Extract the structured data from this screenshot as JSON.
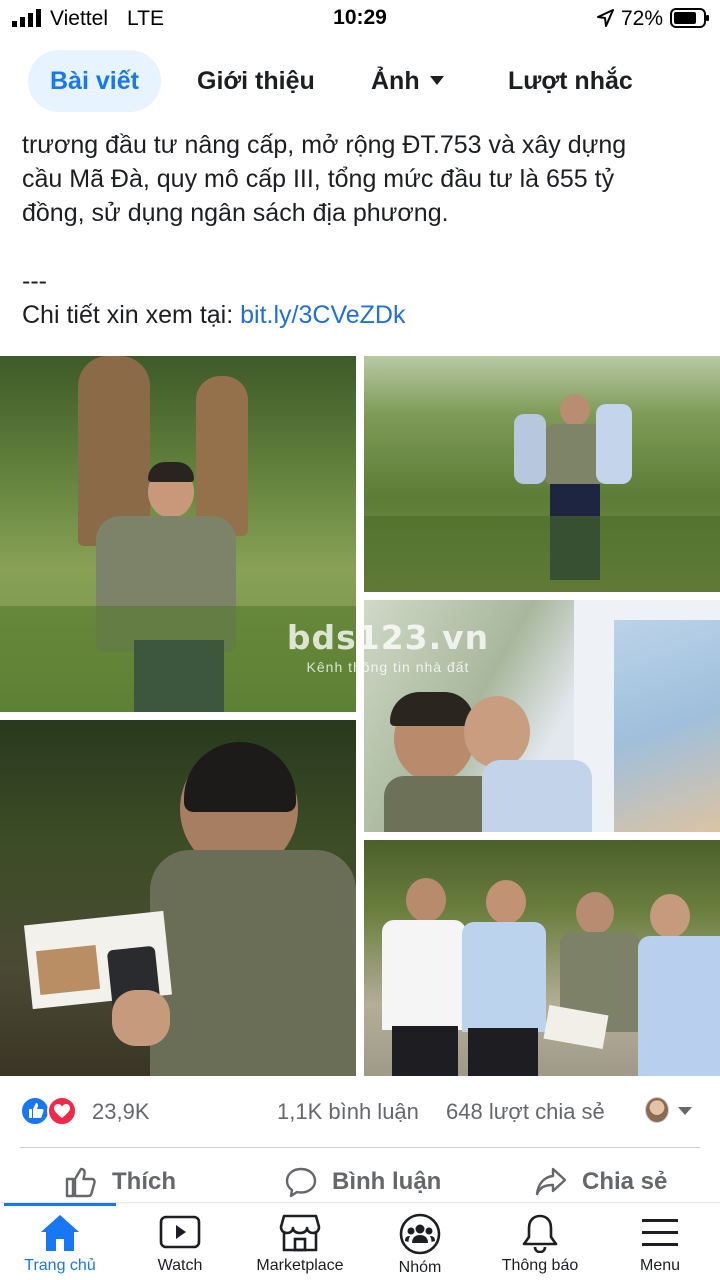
{
  "status_bar": {
    "carrier": "Viettel",
    "network": "LTE",
    "time": "10:29",
    "battery": "72%"
  },
  "tabs": [
    {
      "label": "Bài viết",
      "active": true
    },
    {
      "label": "Giới thiệu",
      "active": false
    },
    {
      "label": "Ảnh",
      "active": false
    },
    {
      "label": "Lượt nhắc",
      "active": false
    }
  ],
  "post": {
    "lines": [
      "trương đầu tư nâng cấp, mở rộng ĐT.753 và xây dựng",
      "cầu Mã Đà, quy mô cấp III, tổng mức đầu tư là 655 tỷ",
      "đồng, sử dụng ngân sách địa phương."
    ],
    "separator": "---",
    "link_prefix": "Chi tiết xin xem tại:",
    "link_text": "bit.ly/3CVeZDk"
  },
  "watermark": {
    "main": "bds123.vn",
    "sub": "Kênh thông tin nhà đất"
  },
  "stats": {
    "reactions": "23,9K",
    "comments": "1,1K bình luận",
    "shares": "648 lượt chia sẻ"
  },
  "actions": {
    "like": "Thích",
    "comment": "Bình luận",
    "share": "Chia sẻ"
  },
  "bottom_nav": [
    {
      "label": "Trang chủ",
      "icon": "home-icon",
      "active": true
    },
    {
      "label": "Watch",
      "icon": "watch-icon",
      "active": false
    },
    {
      "label": "Marketplace",
      "icon": "marketplace-icon",
      "active": false
    },
    {
      "label": "Nhóm",
      "icon": "groups-icon",
      "active": false
    },
    {
      "label": "Thông báo",
      "icon": "bell-icon",
      "active": false
    },
    {
      "label": "Menu",
      "icon": "menu-icon",
      "active": false
    }
  ],
  "colors": {
    "accent": "#1877f2",
    "link": "#216fdb",
    "muted": "#65676b"
  }
}
